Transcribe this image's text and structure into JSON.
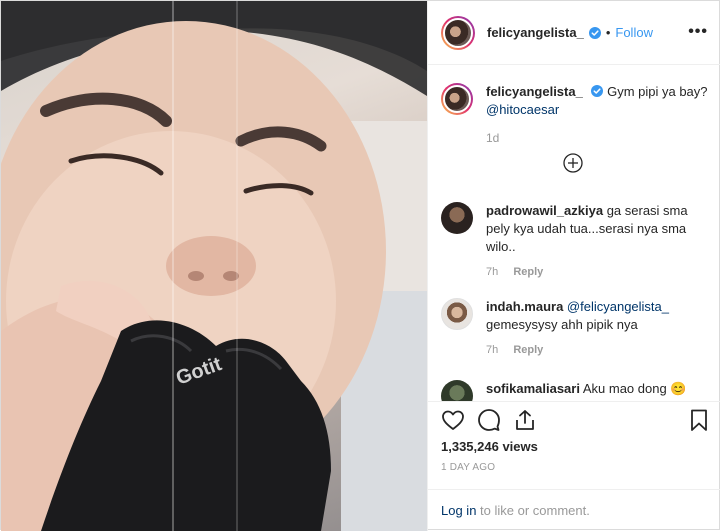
{
  "header": {
    "username": "felicyangelista_",
    "dot": "•",
    "follow_label": "Follow",
    "more_label": "•••"
  },
  "caption": {
    "username": "felicyangelista_",
    "text": "Gym pipi ya bay?",
    "mention": "@hitocaesar",
    "time": "1d"
  },
  "comments": [
    {
      "username": "padrowawil_azkiya",
      "text": "ga serasi sma pely kya udah tua...serasi nya sma wilo..",
      "time": "7h",
      "reply": "Reply"
    },
    {
      "username": "indah.maura",
      "mention": "@felicyangelista_",
      "text": "gemesysysy ahh pipik nya",
      "time": "7h",
      "reply": "Reply"
    },
    {
      "username": "sofikamaliasari",
      "text": "Aku mao dong 😊"
    }
  ],
  "stats": {
    "views": "1,335,246 views",
    "date": "1 DAY AGO"
  },
  "login": {
    "link": "Log in",
    "rest": " to like or comment."
  },
  "media": {
    "glove_text": "Gotit"
  },
  "colors": {
    "accent": "#3897f0",
    "verified": "#3897f0",
    "mention": "#003569",
    "muted": "#999999"
  },
  "icons": [
    "verified-badge-icon",
    "more-options-icon",
    "load-more-icon",
    "heart-icon",
    "comment-icon",
    "share-icon",
    "bookmark-icon"
  ]
}
